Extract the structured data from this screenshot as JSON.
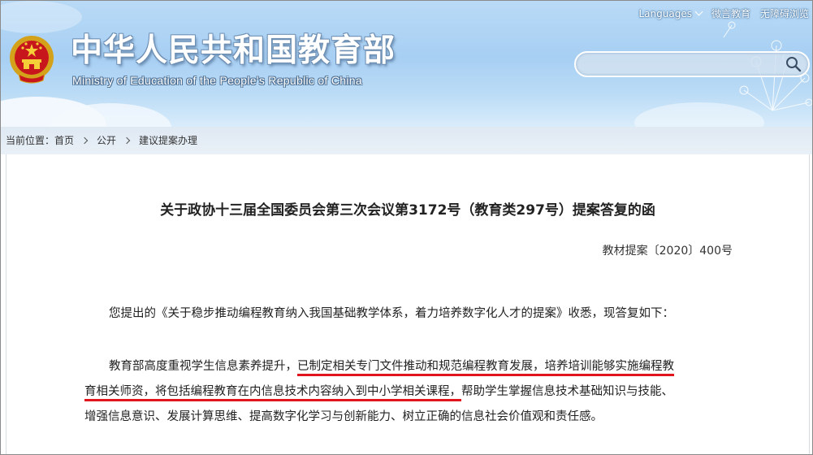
{
  "header": {
    "site_title": "中华人民共和国教育部",
    "site_subtitle": "Ministry of Education of the People's Republic of China",
    "top_links": {
      "languages": "Languages",
      "weibo": "微言教育",
      "accessibility": "无障碍浏览"
    },
    "search": {
      "value": "",
      "placeholder": ""
    },
    "emblem_icon": "national-emblem-icon"
  },
  "breadcrumb": {
    "label": "当前位置：",
    "items": [
      "首页",
      "公开",
      "建议提案办理"
    ]
  },
  "document": {
    "title": "关于政协十三届全国委员会第三次会议第3172号（教育类297号）提案答复的函",
    "number": "教材提案〔2020〕400号",
    "para1": "您提出的《关于稳步推动编程教育纳入我国基础教学体系，着力培养数字化人才的提案》收悉，现答复如下：",
    "para2": {
      "line1_a": "教育部高度重视学生信息素养提升，",
      "line1_b": "已制定相关专门文件推动和规范编程教育发展，培养培训能够实施编程教",
      "line2_a": "育相关师资，将包括编程教育在内信息技术内容纳入到中小学相关课程，",
      "line2_b": "帮助学生掌握信息技术基础知识与技能、",
      "line3": "增强信息意识、发展计算思维、提高数字化学习与创新能力、树立正确的信息社会价值观和责任感。"
    }
  },
  "colors": {
    "header_sky": "#a7cff3",
    "underline_red": "#e0151d",
    "breadcrumb_bg": "#e4edf6"
  }
}
